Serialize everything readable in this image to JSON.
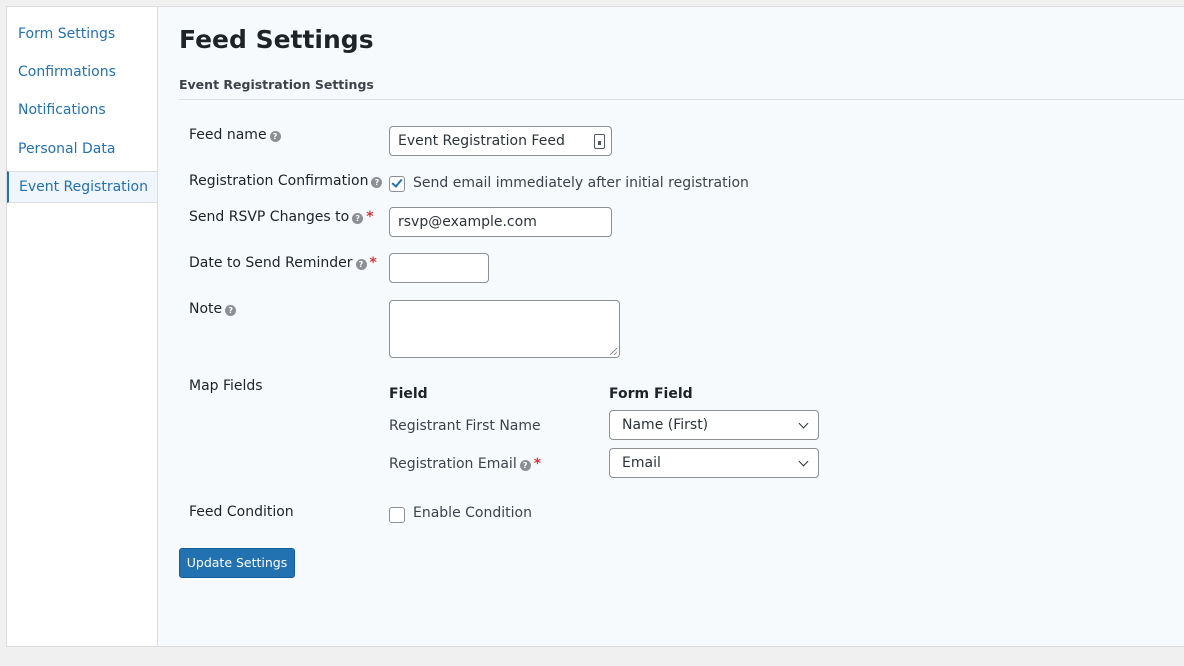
{
  "sidebar": {
    "items": [
      {
        "label": "Form Settings",
        "active": false
      },
      {
        "label": "Confirmations",
        "active": false
      },
      {
        "label": "Notifications",
        "active": false
      },
      {
        "label": "Personal Data",
        "active": false
      },
      {
        "label": "Event Registration",
        "active": true
      }
    ]
  },
  "page": {
    "title": "Feed Settings",
    "section_title": "Event Registration Settings"
  },
  "fields": {
    "feed_name": {
      "label": "Feed name",
      "value": "Event Registration Feed"
    },
    "registration_confirmation": {
      "label": "Registration Confirmation",
      "checkbox_label": "Send email immediately after initial registration",
      "checked": true
    },
    "send_rsvp": {
      "label": "Send RSVP Changes to",
      "value": "rsvp@example.com",
      "required": "*"
    },
    "reminder_date": {
      "label": "Date to Send Reminder",
      "value": "",
      "required": "*"
    },
    "note": {
      "label": "Note",
      "value": ""
    },
    "map_fields": {
      "label": "Map Fields",
      "col_field": "Field",
      "col_form_field": "Form Field",
      "rows": [
        {
          "field": "Registrant First Name",
          "form_field": "Name (First)"
        },
        {
          "field": "Registration Email",
          "form_field": "Email",
          "required": "*"
        }
      ]
    },
    "feed_condition": {
      "label": "Feed Condition",
      "checkbox_label": "Enable Condition",
      "checked": false
    }
  },
  "buttons": {
    "update": "Update Settings"
  },
  "colors": {
    "accent": "#2271b1",
    "required": "#d63638"
  }
}
